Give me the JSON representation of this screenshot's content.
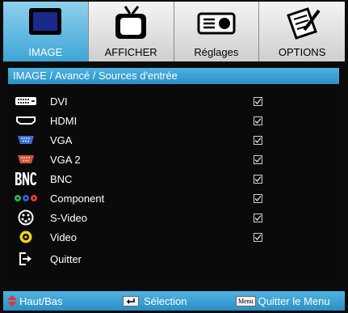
{
  "tabs": [
    {
      "label": "IMAGE",
      "icon": "monitor-icon",
      "active": true
    },
    {
      "label": "AFFICHER",
      "icon": "tv-icon",
      "active": false
    },
    {
      "label": "Réglages",
      "icon": "projector-icon",
      "active": false
    },
    {
      "label": "OPTIONS",
      "icon": "notepad-icon",
      "active": false
    }
  ],
  "breadcrumb": "IMAGE / Avancé / Sources d'entrée",
  "items": [
    {
      "label": "DVI",
      "icon": "dvi-connector-icon",
      "checked": true
    },
    {
      "label": "HDMI",
      "icon": "hdmi-connector-icon",
      "checked": true
    },
    {
      "label": "VGA",
      "icon": "vga-connector-icon",
      "checked": true
    },
    {
      "label": "VGA 2",
      "icon": "vga2-connector-icon",
      "checked": true
    },
    {
      "label": "BNC",
      "icon": "bnc-icon",
      "checked": true
    },
    {
      "label": "Component",
      "icon": "component-rgb-icon",
      "checked": true
    },
    {
      "label": "S-Video",
      "icon": "svideo-connector-icon",
      "checked": true
    },
    {
      "label": "Video",
      "icon": "composite-video-icon",
      "checked": true
    },
    {
      "label": "Quitter",
      "icon": "exit-icon",
      "checked": null
    }
  ],
  "footer": {
    "nav_label": "Haut/Bas",
    "select_label": "Sélection",
    "menu_key": "Menu",
    "exit_label": "Quitter le Menu"
  },
  "colors": {
    "accent": "#3ea6d6",
    "background": "#0b0b0b",
    "text": "#ffffff"
  }
}
